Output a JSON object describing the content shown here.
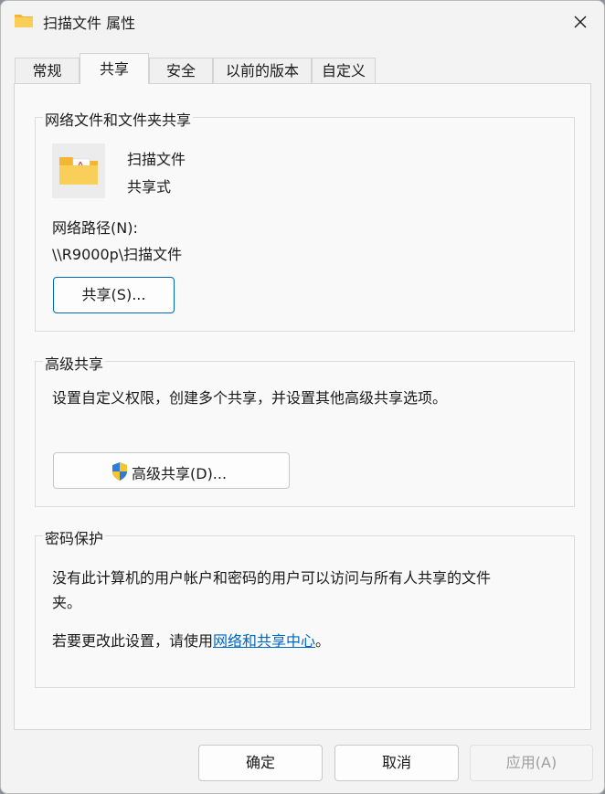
{
  "window": {
    "title": "扫描文件 属性"
  },
  "tabs": [
    {
      "label": "常规"
    },
    {
      "label": "共享"
    },
    {
      "label": "安全"
    },
    {
      "label": "以前的版本"
    },
    {
      "label": "自定义"
    }
  ],
  "network_sharing": {
    "legend": "网络文件和文件夹共享",
    "folder_name": "扫描文件",
    "share_status": "共享式",
    "path_label": "网络路径(N):",
    "path_value": "\\\\R9000p\\扫描文件",
    "share_button": "共享(S)..."
  },
  "advanced_sharing": {
    "legend": "高级共享",
    "description": "设置自定义权限，创建多个共享，并设置其他高级共享选项。",
    "button": "高级共享(D)..."
  },
  "password_protection": {
    "legend": "密码保护",
    "description_line1": "没有此计算机的用户帐户和密码的用户可以访问与所有人共享的文件",
    "description_line2": "夹。",
    "change_prefix": "若要更改此设置，请使用",
    "change_link": "网络和共享中心",
    "change_suffix": "。"
  },
  "footer": {
    "ok": "确定",
    "cancel": "取消",
    "apply": "应用(A)"
  },
  "icons": {
    "title": "folder-icon",
    "close": "close-icon",
    "folder": "shared-folder-icon",
    "shield": "uac-shield-icon"
  },
  "colors": {
    "accent": "#0067c0",
    "folder": "#f7c64a"
  }
}
